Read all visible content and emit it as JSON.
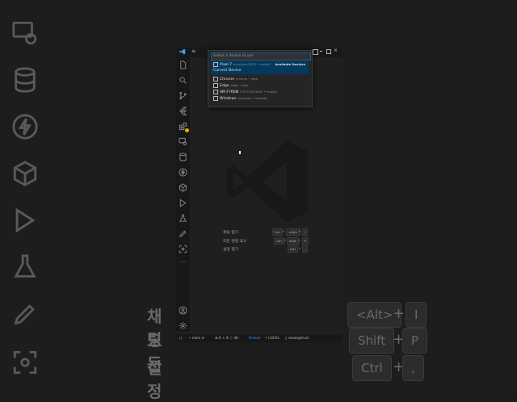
{
  "backdrop": {
    "labels": [
      "채팅",
      "모든",
      "설정"
    ],
    "keys": [
      "<Alt>",
      "I",
      "Shift",
      "P",
      "Ctrl",
      ","
    ]
  },
  "command_center": {
    "placeholder": "Select a device to use"
  },
  "device_picker": {
    "items": [
      {
        "name": "Pixel 7",
        "detail": "emulator-5554 • mobile",
        "badge": "Available Devices"
      },
      {
        "name": "Chrome",
        "detail": "chrome • web",
        "badge": ""
      },
      {
        "name": "Edge",
        "detail": "edge • web",
        "badge": ""
      },
      {
        "name": "SM F766N",
        "detail": "R3CY7001VMV • mobile",
        "badge": ""
      },
      {
        "name": "Windows",
        "detail": "windows • desktop",
        "badge": ""
      }
    ],
    "category": "Current Device"
  },
  "activity_icons": [
    "explorer-icon",
    "search-icon",
    "source-control-icon",
    "flutter-icon",
    "extensions-icon",
    "remote-explorer-icon",
    "database-icon",
    "thunder-client-icon",
    "containers-icon",
    "deploy-icon",
    "testing-icon",
    "pen-icon",
    "screen-capture-icon",
    "more-icon"
  ],
  "shortcuts": [
    {
      "label": "채팅 열기",
      "keys": [
        "Ctrl",
        "<Alt>",
        "I"
      ]
    },
    {
      "label": "모든 명령 표시",
      "keys": [
        "Ctrl",
        "Shift",
        "P"
      ]
    },
    {
      "label": "설정 열기",
      "keys": [
        "Ctrl",
        ","
      ]
    }
  ],
  "statusbar": {
    "branch": "main",
    "errors": "0",
    "warnings": "8",
    "info": "46",
    "docker": "Docker",
    "local": "LOCAL",
    "user": "seoangtruck"
  },
  "colors": {
    "accent": "#0e639c",
    "selection": "#04395e",
    "link": "#3794ff"
  }
}
